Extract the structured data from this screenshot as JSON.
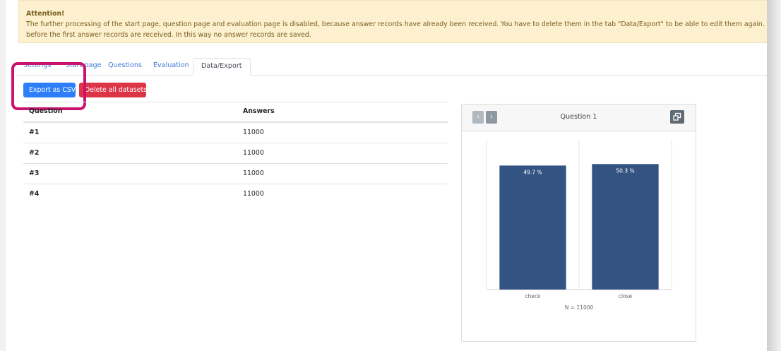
{
  "alert": {
    "title": "Attention!",
    "line1": "The further processing of the start page, question page and evaluation page is disabled, because answer records have already been received. You have to delete them in the tab \"Data/Export\" to be able to edit them again. You can also activate th",
    "line2": "before the first answer records are received. In this way no answer records are saved."
  },
  "tabs": [
    {
      "label": "Settings"
    },
    {
      "label": "Start page"
    },
    {
      "label": "Questions"
    },
    {
      "label": "Evaluation"
    },
    {
      "label": "Data/Export"
    }
  ],
  "buttons": {
    "export": "Export as CSV",
    "delete": "Delete all datasets"
  },
  "table": {
    "headers": [
      "Question",
      "Answers"
    ],
    "rows": [
      {
        "question": "#1",
        "answers": "11000"
      },
      {
        "question": "#2",
        "answers": "11000"
      },
      {
        "question": "#3",
        "answers": "11000"
      },
      {
        "question": "#4",
        "answers": "11000"
      }
    ]
  },
  "card": {
    "title": "Question 1",
    "prev_icon": "‹",
    "next_icon": "›",
    "icons": [
      "chevron-left-icon",
      "chevron-right-icon",
      "expand-window-icon"
    ]
  },
  "colors": {
    "primary": "#2d7ff9",
    "danger": "#dc3545",
    "highlight": "#c8146e",
    "bar": "#335483"
  },
  "chart_data": {
    "type": "bar",
    "categories": [
      "check",
      "close"
    ],
    "values": [
      49.7,
      50.3
    ],
    "data_labels": [
      "49.7 %",
      "50.3 %"
    ],
    "ylim": [
      0,
      60
    ],
    "footnote": "N = 11000",
    "grid": true
  }
}
